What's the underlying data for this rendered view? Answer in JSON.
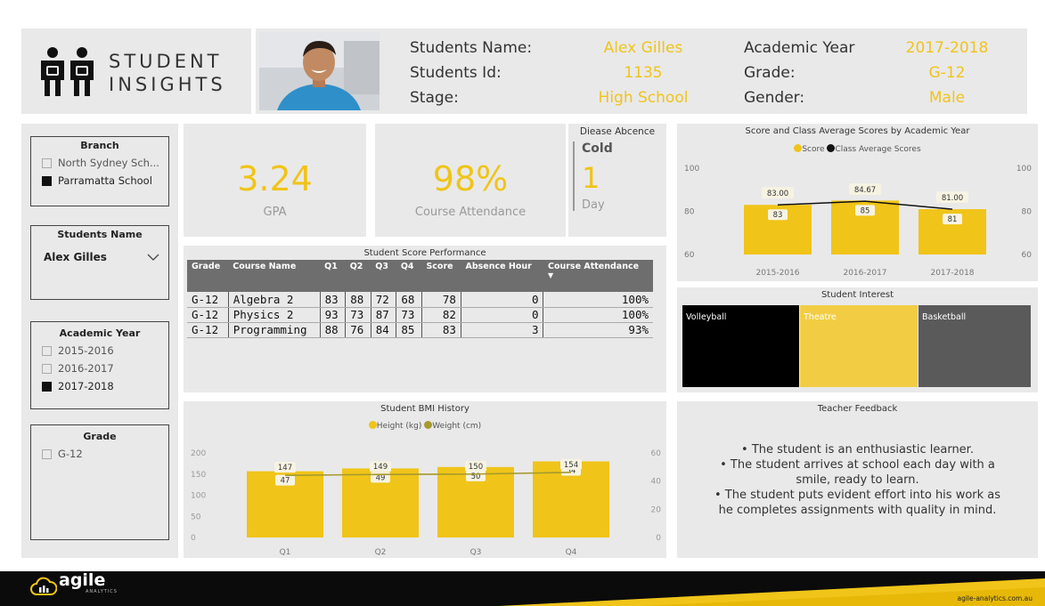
{
  "brand": {
    "title_line1": "STUDENT",
    "title_line2": "INSIGHTS"
  },
  "profile": {
    "name_label": "Students Name:",
    "name_value": "Alex Gilles",
    "id_label": "Students Id:",
    "id_value": "1135",
    "stage_label": "Stage:",
    "stage_value": "High School",
    "year_label": "Academic Year",
    "year_value": "2017-2018",
    "grade_label": "Grade:",
    "grade_value": "G-12",
    "gender_label": "Gender:",
    "gender_value": "Male"
  },
  "filters": {
    "branch": {
      "title": "Branch",
      "options": [
        {
          "label": "North Sydney Sch...",
          "selected": false
        },
        {
          "label": "Parramatta School",
          "selected": true
        }
      ]
    },
    "student_name": {
      "title": "Students Name",
      "value": "Alex Gilles"
    },
    "academic_year": {
      "title": "Academic Year",
      "options": [
        {
          "label": "2015-2016",
          "selected": false
        },
        {
          "label": "2016-2017",
          "selected": false
        },
        {
          "label": "2017-2018",
          "selected": true
        }
      ]
    },
    "grade": {
      "title": "Grade",
      "options": [
        {
          "label": "G-12",
          "selected": false
        }
      ]
    }
  },
  "kpis": {
    "gpa": {
      "value": "3.24",
      "label": "GPA"
    },
    "attendance": {
      "value": "98%",
      "label": "Course Attendance"
    },
    "disease": {
      "title": "Diease Abcence",
      "type": "Cold",
      "value": "1",
      "unit": "Day"
    }
  },
  "score_table": {
    "title": "Student Score Performance",
    "headers": [
      "Grade",
      "Course Name",
      "Q1",
      "Q2",
      "Q3",
      "Q4",
      "Score",
      "Absence Hour",
      "Course Attendance"
    ],
    "rows": [
      [
        "G-12",
        "Algebra 2",
        "83",
        "88",
        "72",
        "68",
        "78",
        "0",
        "100%"
      ],
      [
        "G-12",
        "Physics 2",
        "93",
        "73",
        "87",
        "73",
        "82",
        "0",
        "100%"
      ],
      [
        "G-12",
        "Programming",
        "88",
        "76",
        "84",
        "85",
        "83",
        "3",
        "93%"
      ]
    ]
  },
  "interest": {
    "title": "Student Interest",
    "items": [
      {
        "label": "Volleyball",
        "color": "#000000"
      },
      {
        "label": "Theatre",
        "color": "#f2cd44"
      },
      {
        "label": "Basketball",
        "color": "#5a5a5a"
      }
    ]
  },
  "feedback": {
    "title": "Teacher Feedback",
    "lines": [
      "• The student is an enthusiastic learner.",
      "• The student arrives at school each day with a",
      "smile, ready to learn.",
      "• The student puts evident effort into his work as",
      "he completes assignments with quality in mind."
    ]
  },
  "footer": {
    "logo_text": "agile",
    "logo_sub": "ANALYTICS",
    "url": "agile-analytics.com.au"
  },
  "colors": {
    "accent": "#f0c419",
    "panel": "#e9e9e9",
    "dark": "#111111",
    "olive": "#a59a2e"
  },
  "chart_data": [
    {
      "type": "bar",
      "title": "Score and Class Average Scores by Academic Year",
      "legend": [
        "Score",
        "Class Average Scores"
      ],
      "legend_position": "top",
      "categories": [
        "2015-2016",
        "2016-2017",
        "2017-2018"
      ],
      "series": [
        {
          "name": "Score",
          "values": [
            83,
            85,
            81
          ],
          "labels": [
            "83",
            "85",
            "81"
          ],
          "color": "#f0c419",
          "kind": "bar"
        },
        {
          "name": "Class Average Scores",
          "values": [
            83.0,
            84.67,
            81.0
          ],
          "labels": [
            "83.00",
            "84.67",
            "81.00"
          ],
          "color": "#111111",
          "kind": "line"
        }
      ],
      "ylim": [
        60,
        100
      ],
      "yticks": [
        "100",
        "80",
        "60"
      ]
    },
    {
      "type": "bar",
      "title": "Student BMI History",
      "legend": [
        "Height (kg)",
        "Weight (cm)"
      ],
      "legend_position": "top",
      "categories": [
        "Q1",
        "Q2",
        "Q3",
        "Q4"
      ],
      "series": [
        {
          "name": "Height (kg)",
          "values": [
            47,
            49,
            50,
            54
          ],
          "color": "#f0c419",
          "kind": "bar",
          "axis": "right"
        },
        {
          "name": "Weight (cm)",
          "values": [
            147,
            149,
            150,
            154
          ],
          "color": "#a59a2e",
          "kind": "line",
          "axis": "left"
        }
      ],
      "ylim_left": [
        0,
        200
      ],
      "ylim_right": [
        0,
        60
      ],
      "yticks_left": [
        "200",
        "150",
        "100",
        "50",
        "0"
      ],
      "yticks_right": [
        "60",
        "40",
        "20",
        "0"
      ]
    }
  ]
}
